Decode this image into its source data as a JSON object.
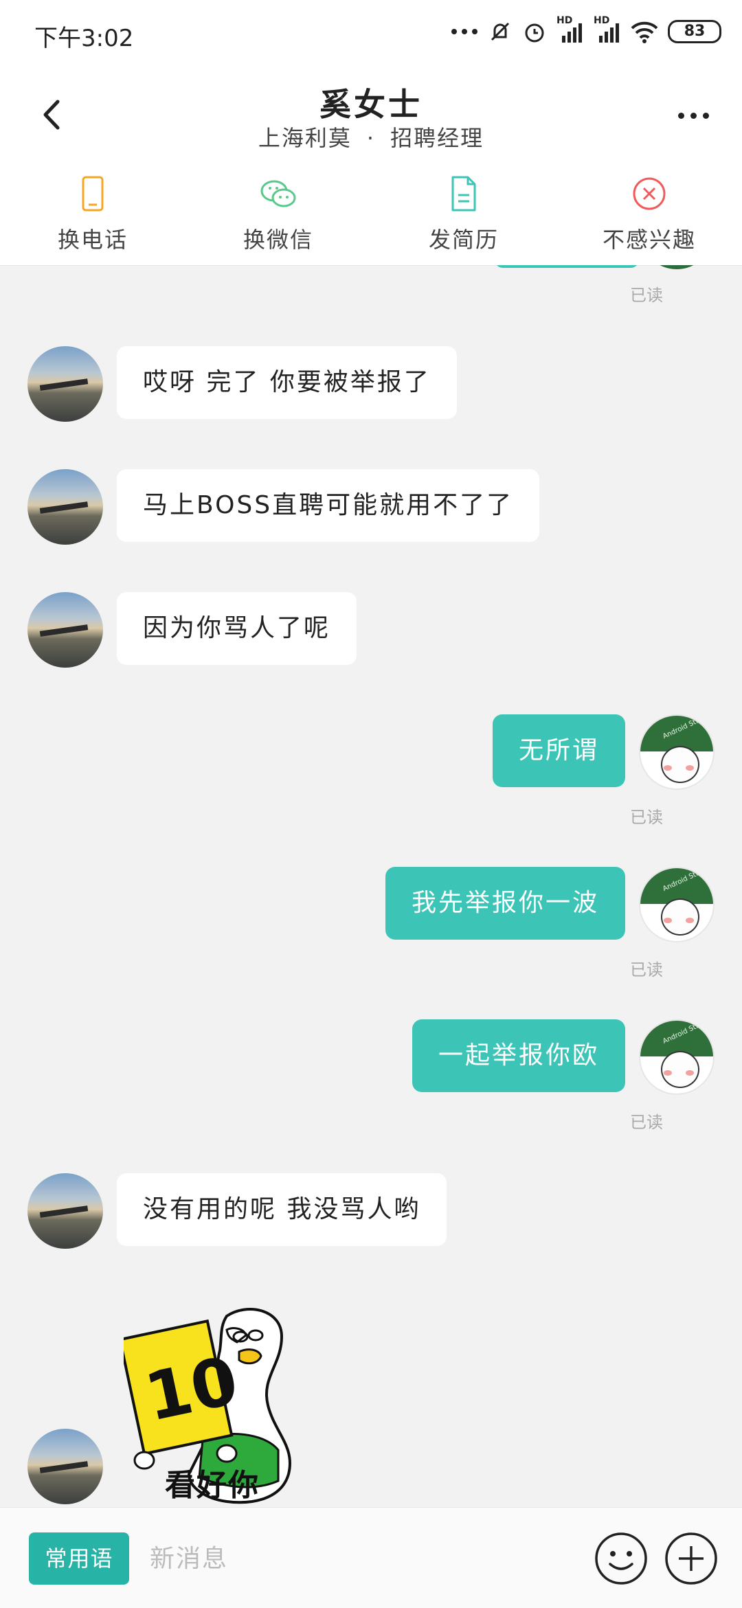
{
  "status": {
    "time": "下午3:02",
    "battery": "83",
    "hd1": "HD",
    "hd2": "HD"
  },
  "header": {
    "title": "奚女士",
    "company": "上海利莫",
    "separator": "·",
    "position": "招聘经理"
  },
  "actions": [
    {
      "label": "换电话",
      "icon": "phone-icon",
      "color": "#f5a623"
    },
    {
      "label": "换微信",
      "icon": "wechat-icon",
      "color": "#5ac88a"
    },
    {
      "label": "发简历",
      "icon": "resume-icon",
      "color": "#3cc5b7"
    },
    {
      "label": "不感兴趣",
      "icon": "not-interested-icon",
      "color": "#f05a5a"
    }
  ],
  "messages": [
    {
      "side": "in",
      "text": "哎呀 完了 你要被举报了"
    },
    {
      "side": "in",
      "text": "马上BOSS直聘可能就用不了了"
    },
    {
      "side": "in",
      "text": "因为你骂人了呢"
    },
    {
      "side": "out",
      "text": "无所谓",
      "status": "已读"
    },
    {
      "side": "out",
      "text": "我先举报你一波",
      "status": "已读"
    },
    {
      "side": "out",
      "text": "一起举报你欧",
      "status": "已读"
    },
    {
      "side": "in",
      "text": "没有用的呢 我没骂人哟"
    }
  ],
  "top_read_status": "已读",
  "sticker": {
    "number": "10",
    "caption": "看好你"
  },
  "input": {
    "phrases_label": "常用语",
    "placeholder": "新消息"
  },
  "colors": {
    "accent": "#3cc5b7",
    "button": "#27b4a7"
  }
}
